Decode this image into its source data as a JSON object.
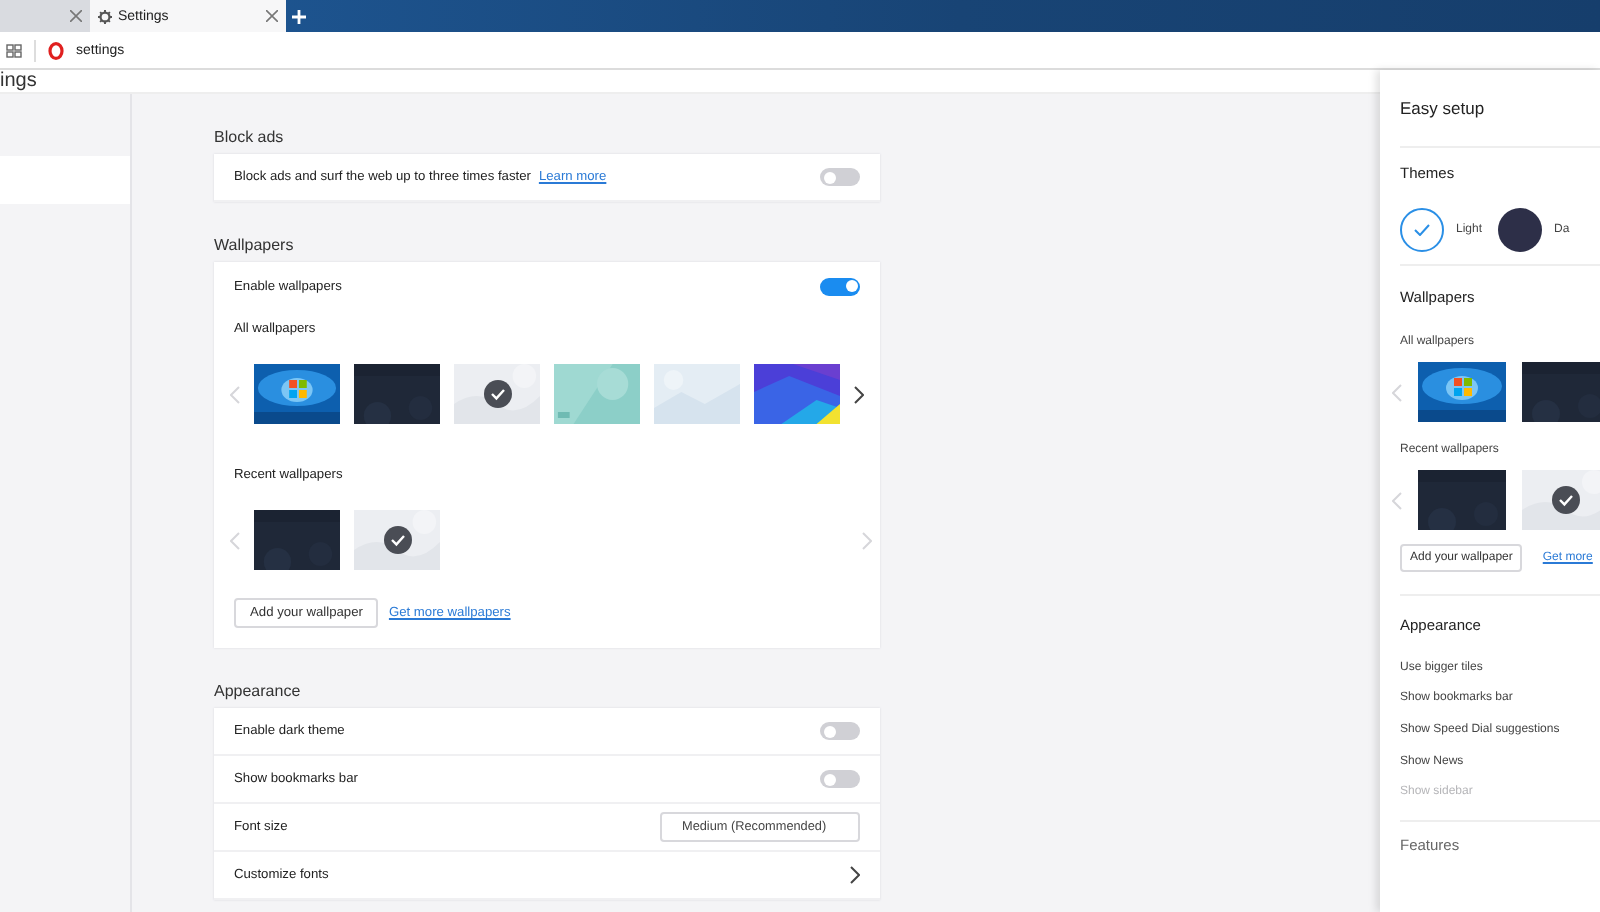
{
  "tabs": [
    {
      "kind": "blank",
      "selected": false
    },
    {
      "kind": "settings",
      "label": "Settings",
      "selected": true
    }
  ],
  "address_bar": {
    "url": "settings"
  },
  "page_title": "ings",
  "block_ads": {
    "title": "Block ads",
    "text": "Block ads and surf the web up to three times faster",
    "link": "Learn more",
    "on": false
  },
  "wallpapers": {
    "title": "Wallpapers",
    "enable_label": "Enable wallpapers",
    "on": true,
    "all_label": "All wallpapers",
    "all": [
      {
        "kind": "windows",
        "selected": false
      },
      {
        "kind": "dark",
        "selected": false
      },
      {
        "kind": "light",
        "selected": true
      },
      {
        "kind": "teal",
        "selected": false
      },
      {
        "kind": "pale",
        "selected": false
      },
      {
        "kind": "purple",
        "selected": false
      }
    ],
    "recent_label": "Recent wallpapers",
    "recent": [
      {
        "kind": "dark",
        "selected": false
      },
      {
        "kind": "light",
        "selected": true
      }
    ],
    "add_button": "Add your wallpaper",
    "more_link": "Get more wallpapers"
  },
  "appearance": {
    "title": "Appearance",
    "rows": [
      {
        "kind": "toggle",
        "label": "Enable dark theme",
        "on": false
      },
      {
        "kind": "toggle",
        "label": "Show bookmarks bar",
        "on": false
      },
      {
        "kind": "select",
        "label": "Font size",
        "value": "Medium (Recommended)"
      },
      {
        "kind": "link",
        "label": "Customize fonts"
      }
    ]
  },
  "easy_setup": {
    "title": "Easy setup",
    "themes_title": "Themes",
    "themes": [
      {
        "kind": "light",
        "label": "Light",
        "selected": true
      },
      {
        "kind": "dark",
        "label": "Da",
        "selected": false
      }
    ],
    "wallpapers_title": "Wallpapers",
    "all_label": "All wallpapers",
    "all": [
      {
        "kind": "windows",
        "selected": false
      },
      {
        "kind": "dark",
        "selected": false
      }
    ],
    "recent_label": "Recent wallpapers",
    "recent": [
      {
        "kind": "dark",
        "selected": false
      },
      {
        "kind": "light",
        "selected": true
      }
    ],
    "add_button": "Add your wallpaper",
    "more_link": "Get more",
    "appearance_title": "Appearance",
    "options": [
      {
        "label": "Use bigger tiles",
        "disabled": false
      },
      {
        "label": "Show bookmarks bar",
        "disabled": false
      },
      {
        "label": "Show Speed Dial suggestions",
        "disabled": false
      },
      {
        "label": "Show News",
        "disabled": false
      },
      {
        "label": "Show sidebar",
        "disabled": true
      }
    ],
    "features_title": "Features"
  }
}
